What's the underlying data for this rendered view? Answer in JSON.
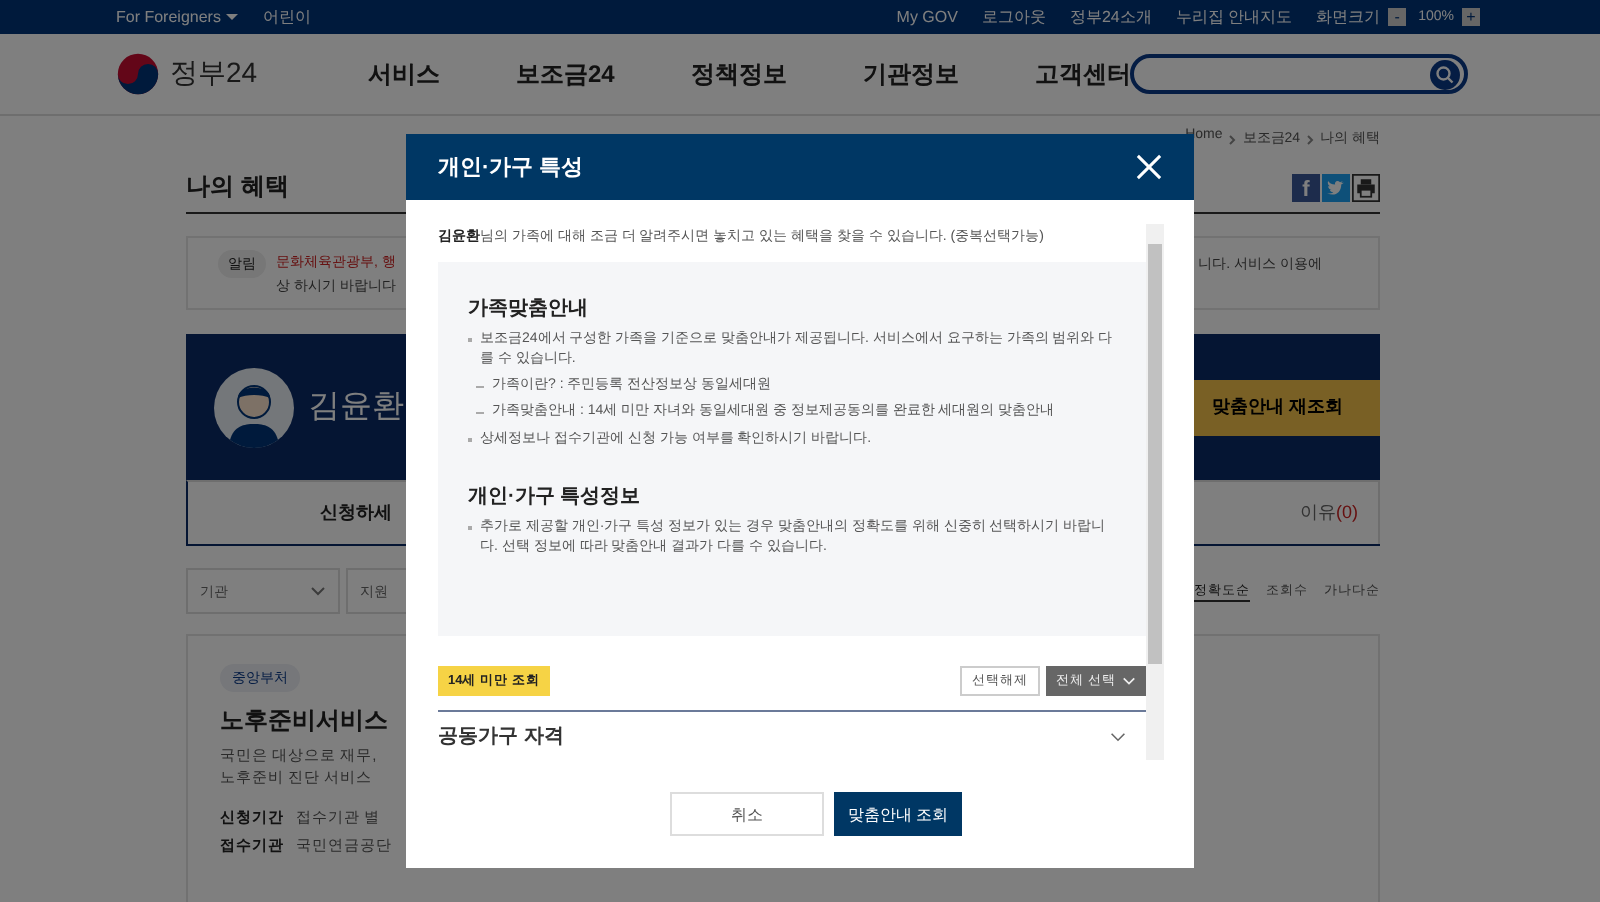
{
  "top_bar": {
    "left_links": [
      {
        "label": "For Foreigners",
        "dropdown": true
      },
      {
        "label": "어린이",
        "dropdown": false
      }
    ],
    "right_links": [
      "My GOV",
      "로그아웃",
      "정부24소개",
      "누리집 안내지도"
    ],
    "font_size": {
      "label": "화면크기",
      "minus": "-",
      "value": "100%",
      "plus": "+"
    }
  },
  "header": {
    "logo": "정부24",
    "nav": [
      "서비스",
      "보조금24",
      "정책정보",
      "기관정보",
      "고객센터"
    ]
  },
  "breadcrumb": [
    "Home",
    "보조금24",
    "나의 혜택"
  ],
  "page_title": "나의 혜택",
  "notice": {
    "label": "알림",
    "line_1": "문화체육관광부, 행",
    "line_2": "상 하시기 바랍니다",
    "right_text": "니다. 서비스 이용에"
  },
  "profile": {
    "name": "김윤환",
    "button": "맞춤안내 재조회"
  },
  "tabs": [
    {
      "label": "신청하세",
      "selected": true
    },
    {
      "label": "이유",
      "count": "(0)",
      "selected": false
    }
  ],
  "filters": [
    {
      "label": "기관"
    },
    {
      "label": "지원"
    }
  ],
  "sort_options": [
    {
      "label": "정확도순",
      "selected": true
    },
    {
      "label": "조회수",
      "selected": false
    },
    {
      "label": "가나다순",
      "selected": false
    }
  ],
  "card": {
    "tag": "중앙부처",
    "title": "노후준비서비스",
    "description": [
      "국민은 대상으로 재무,",
      "노후준비 진단 서비스"
    ],
    "details": [
      {
        "label": "신청기간",
        "value": "접수기관 별"
      },
      {
        "label": "접수기관",
        "value": "국민연금공단"
      }
    ]
  },
  "share": {
    "facebook": "f"
  },
  "modal": {
    "title": "개인·가구 특성",
    "intro": "**김윤환**님의 가족에 대해 조금 더 알려주시면 놓치고 있는 혜택을 찾을 수 있습니다. (중복선택가능)",
    "sections": [
      {
        "heading": "가족맞춤안내",
        "bullets": [
          {
            "text": "보조금24에서 구성한 가족을 기준으로 맞춤안내가 제공됩니다. 서비스에서 요구하는 가족의 범위와 다를 수 있습니다.",
            "children": [
              "가족이란? : 주민등록 전산정보상 동일세대원",
              "가족맞춤안내 : 14세 미만 자녀와 동일세대원 중 정보제공동의를 완료한 세대원의 맞춤안내"
            ]
          },
          {
            "text": "상세정보나 접수기관에 신청 가능 여부를 확인하시기 바랍니다."
          }
        ]
      },
      {
        "heading": "개인·가구 특성정보",
        "bullets": [
          {
            "text": "추가로 제공할 개인·가구 특성 정보가 있는 경우 맞춤안내의 정확도를 위해 신중히 선택하시기 바랍니다. 선택 정보에 따라 맞춤안내 결과가 다를 수 있습니다."
          }
        ]
      }
    ],
    "tag": "14세 미만 조회",
    "clear_button": "선택해제",
    "select_all_button": "전체 선택",
    "accordion": {
      "label": "공동가구 자격",
      "expanded": false
    },
    "buttons": [
      {
        "label": "취소",
        "kind": "secondary"
      },
      {
        "label": "맞춤안내 조회",
        "kind": "primary"
      }
    ]
  }
}
